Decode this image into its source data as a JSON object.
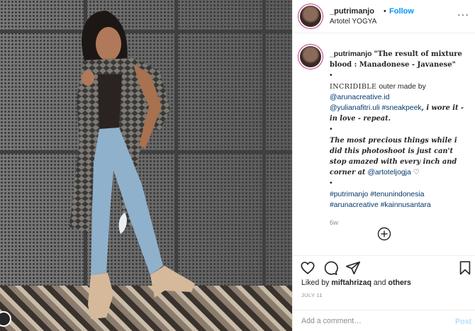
{
  "header": {
    "username": "_putrimanjo",
    "separator": "•",
    "follow_label": "Follow",
    "location": "Artotel YOGYA",
    "more_label": "···"
  },
  "caption": {
    "username": "_putrimanjo",
    "title": "\"The result of mixture blood : Manadonese - Javanese\"",
    "bullet": "•",
    "incredible": "INCRIDIBLE",
    "outer_text": "outer made by",
    "mention_aruna": "@arunacreative.id",
    "mention_yulia": "@yulianafitri.uli",
    "hashtag_sneakpeek": "#sneakpeek",
    "wore_text": ", i wore it - in love - repeat.",
    "quote_text": "The most precious things while i did this photoshoot is just can't stop amazed with every inch and corner at",
    "mention_artotel": "@artoteljogja",
    "heart": "♡",
    "hashtags_line1": [
      "#putrimanjo",
      "#tenunindonesia"
    ],
    "hashtags_line2": [
      "#arunacreative",
      "#kainnusantara"
    ],
    "age": "6w"
  },
  "icons": {
    "load_more": "plus-circle-icon",
    "like": "heart-icon",
    "comment": "comment-icon",
    "share": "share-icon",
    "save": "bookmark-icon"
  },
  "likes": {
    "prefix": "Liked by",
    "user": "miftahrizaq",
    "and": "and",
    "others": "others"
  },
  "date": "JULY 11",
  "comment_box": {
    "placeholder": "Add a comment…",
    "post_label": "Post"
  },
  "colors": {
    "accent": "#0095f6",
    "link": "#00376b",
    "post_disabled": "#b2dffc",
    "muted": "#8e8e8e"
  }
}
